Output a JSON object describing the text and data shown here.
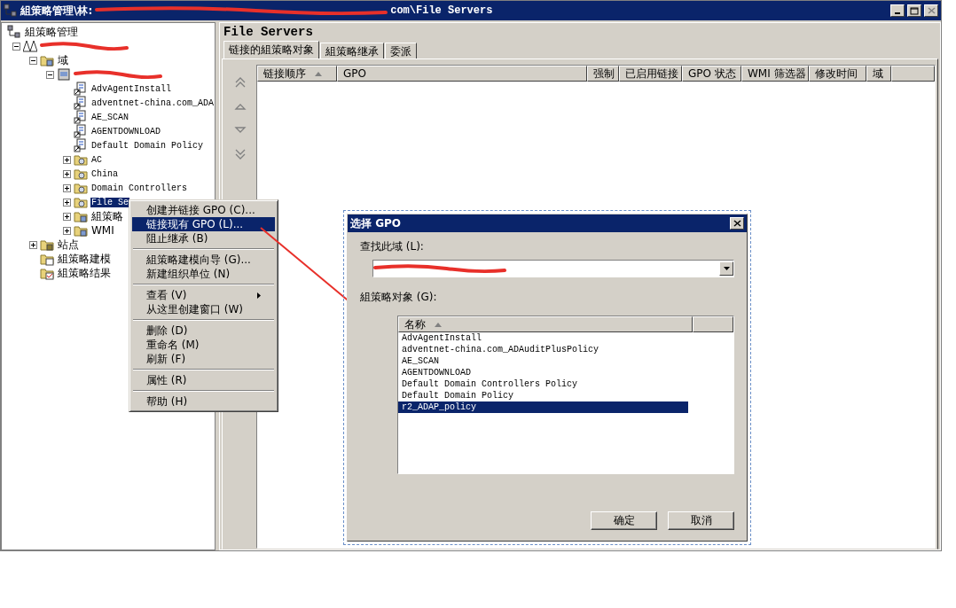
{
  "window": {
    "title": "組策略管理\\林:",
    "title_tail": "com\\File Servers"
  },
  "tree": [
    {
      "kind": "console",
      "label": "組策略管理",
      "selected": false,
      "children": [
        {
          "kind": "forest",
          "expanded": true,
          "selected": false,
          "children": [
            {
              "kind": "domains",
              "label": "域",
              "expanded": true,
              "selected": false,
              "children": [
                {
                  "kind": "domain",
                  "expanded": true,
                  "selected": false,
                  "children": [
                    {
                      "kind": "gpo",
                      "label": "AdvAgentInstall",
                      "selected": false
                    },
                    {
                      "kind": "gpo",
                      "label": "adventnet-china.com_ADA",
                      "selected": false
                    },
                    {
                      "kind": "gpo",
                      "label": "AE_SCAN",
                      "selected": false
                    },
                    {
                      "kind": "gpo",
                      "label": "AGENTDOWNLOAD",
                      "selected": false
                    },
                    {
                      "kind": "gpo",
                      "label": "Default Domain Policy",
                      "selected": false
                    },
                    {
                      "kind": "ou",
                      "label": "AC",
                      "expanded": false,
                      "selected": false
                    },
                    {
                      "kind": "ou",
                      "label": "China",
                      "expanded": false,
                      "selected": false
                    },
                    {
                      "kind": "ou",
                      "label": "Domain Controllers",
                      "expanded": false,
                      "selected": false
                    },
                    {
                      "kind": "ou",
                      "label": "File Se",
                      "expanded": false,
                      "selected": true
                    },
                    {
                      "kind": "gpo-folder",
                      "label": "組策略",
                      "expanded": false,
                      "selected": false
                    },
                    {
                      "kind": "wmi-folder",
                      "label": "WMI",
                      "expanded": false,
                      "selected": false
                    }
                  ]
                }
              ]
            },
            {
              "kind": "sites",
              "label": "站点",
              "expanded": false,
              "selected": false
            },
            {
              "kind": "modeling",
              "label": "組策略建模",
              "selected": false
            },
            {
              "kind": "results",
              "label": "組策略结果",
              "selected": false
            }
          ]
        }
      ]
    }
  ],
  "detail": {
    "heading": "File Servers",
    "tabs": [
      {
        "label": "链接的組策略对象",
        "selected": true
      },
      {
        "label": "組策略继承",
        "selected": false
      },
      {
        "label": "委派",
        "selected": false
      }
    ],
    "columns": [
      {
        "label": "链接顺序",
        "sorted": true
      },
      {
        "label": "GPO"
      },
      {
        "label": "强制"
      },
      {
        "label": "已启用链接"
      },
      {
        "label": "GPO 状态"
      },
      {
        "label": "WMI 筛选器"
      },
      {
        "label": "修改时间"
      },
      {
        "label": "域"
      }
    ],
    "order_buttons": [
      {
        "kind": "top"
      },
      {
        "kind": "up"
      },
      {
        "kind": "down"
      },
      {
        "kind": "bottom"
      }
    ]
  },
  "context_menu": [
    [
      {
        "label": "创建并链接 GPO (C)...",
        "selected": false
      },
      {
        "label": "链接现有 GPO (L)...",
        "selected": true
      },
      {
        "label": "阻止继承 (B)",
        "selected": false
      }
    ],
    [
      {
        "label": "組策略建模向导 (G)...",
        "selected": false
      },
      {
        "label": "新建组织单位 (N)",
        "selected": false
      }
    ],
    [
      {
        "label": "查看 (V)",
        "selected": false,
        "submenu": true
      },
      {
        "label": "从这里创建窗口 (W)",
        "selected": false
      }
    ],
    [
      {
        "label": "删除 (D)",
        "selected": false
      },
      {
        "label": "重命名 (M)",
        "selected": false
      },
      {
        "label": "刷新 (F)",
        "selected": false
      }
    ],
    [
      {
        "label": "属性 (R)",
        "selected": false
      }
    ],
    [
      {
        "label": "帮助 (H)",
        "selected": false
      }
    ]
  ],
  "dialog": {
    "title": "选择 GPO",
    "domain_label": "查找此域 (L):",
    "list_label": "組策略对象 (G):",
    "list_header": "名称",
    "items": [
      {
        "label": "AdvAgentInstall",
        "selected": false
      },
      {
        "label": "adventnet-china.com_ADAuditPlusPolicy",
        "selected": false
      },
      {
        "label": "AE_SCAN",
        "selected": false
      },
      {
        "label": "AGENTDOWNLOAD",
        "selected": false
      },
      {
        "label": "Default Domain Controllers Policy",
        "selected": false
      },
      {
        "label": "Default Domain Policy",
        "selected": false
      },
      {
        "label": "r2_ADAP_policy",
        "selected": true
      }
    ],
    "buttons": [
      "确定",
      "取消"
    ]
  }
}
